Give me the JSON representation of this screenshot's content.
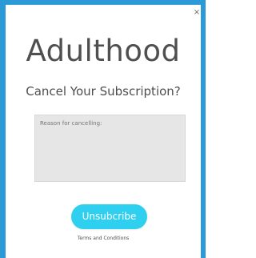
{
  "modal": {
    "close_icon": "×",
    "brand": "Adulthood",
    "subtitle": "Cancel Your Subscription?",
    "reason_placeholder": "Reason for cancelling:",
    "unsubscribe_label": "Unsubcribe",
    "terms_link": "Terms and Conditions"
  },
  "colors": {
    "frame_blue": "#2b9ad6",
    "button_cyan": "#2fd0ef",
    "text_gray": "#4f4f4f",
    "textarea_bg": "#e6e6e6"
  }
}
